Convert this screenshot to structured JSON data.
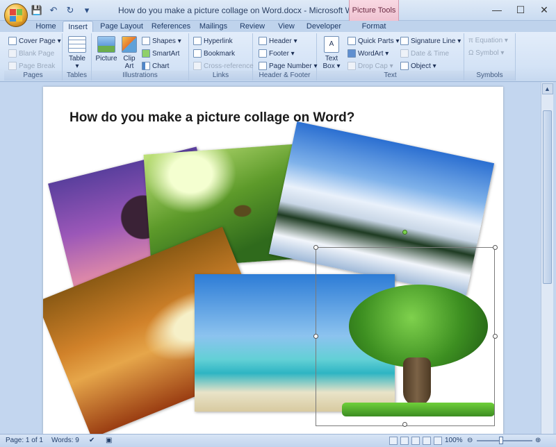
{
  "app": {
    "title": "How do you make a picture collage on Word.docx - Microsoft Word",
    "contextual_tab": "Picture Tools"
  },
  "quick_access": [
    "save-icon",
    "undo-icon",
    "redo-icon",
    "customize-icon"
  ],
  "window_controls": {
    "minimize": "—",
    "maximize": "☐",
    "close": "✕"
  },
  "tabs": [
    "Home",
    "Insert",
    "Page Layout",
    "References",
    "Mailings",
    "Review",
    "View",
    "Developer",
    "Format"
  ],
  "active_tab": "Insert",
  "ribbon": {
    "pages": {
      "label": "Pages",
      "items": [
        "Cover Page ▾",
        "Blank Page",
        "Page Break"
      ]
    },
    "tables": {
      "label": "Tables",
      "table": "Table",
      "table_arrow": "▾"
    },
    "illustrations": {
      "label": "Illustrations",
      "picture": "Picture",
      "clip_art_1": "Clip",
      "clip_art_2": "Art",
      "shapes": "Shapes ▾",
      "smartart": "SmartArt",
      "chart": "Chart"
    },
    "links": {
      "label": "Links",
      "items": [
        "Hyperlink",
        "Bookmark",
        "Cross-reference"
      ]
    },
    "header_footer": {
      "label": "Header & Footer",
      "items": [
        "Header ▾",
        "Footer ▾",
        "Page Number ▾"
      ]
    },
    "text": {
      "label": "Text",
      "text_box_1": "Text",
      "text_box_2": "Box ▾",
      "items": [
        "Quick Parts ▾",
        "WordArt ▾",
        "Drop Cap ▾"
      ],
      "items2": [
        "Signature Line ▾",
        "Date & Time",
        "Object ▾"
      ]
    },
    "symbols": {
      "label": "Symbols",
      "items": [
        "π Equation ▾",
        "Ω Symbol ▾"
      ]
    }
  },
  "document": {
    "heading": "How do you make a picture collage on Word?"
  },
  "status": {
    "page": "Page: 1 of 1",
    "words": "Words: 9",
    "zoom": "100%",
    "zoom_level_percent": 100
  },
  "colors": {
    "ribbon_bg": "#d4e3f6",
    "title_bg": "#dfeaf7",
    "picture_tools": "#efc2d1",
    "workspace": "#c3d6ef"
  }
}
